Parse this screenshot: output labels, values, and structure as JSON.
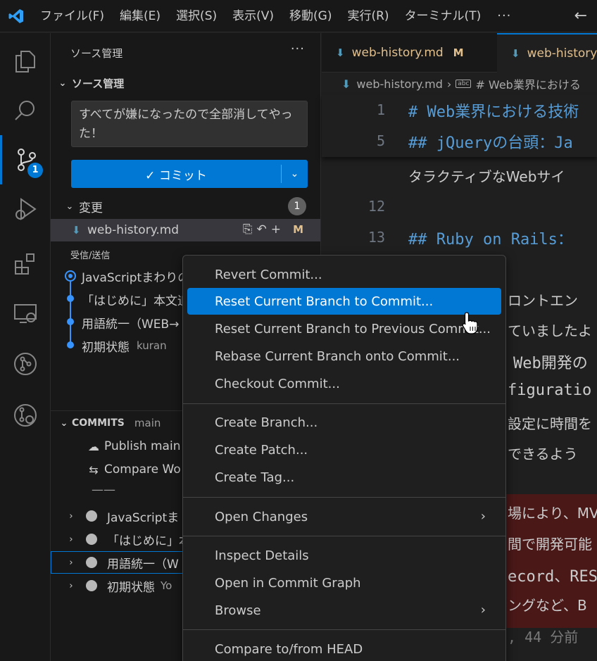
{
  "titlebar": {
    "menus": [
      "ファイル(F)",
      "編集(E)",
      "選択(S)",
      "表示(V)",
      "移動(G)",
      "実行(R)",
      "ターミナル(T)"
    ],
    "more": "···",
    "back": "←"
  },
  "activitybar": {
    "scm_badge": "1"
  },
  "sidebar": {
    "title": "ソース管理",
    "more": "···",
    "scm_section": "ソース管理",
    "commit_message": "すべてが嫌になったので全部消してやった！",
    "commit_button": "✓ コミット",
    "changes_label": "変更",
    "changes_count": "1",
    "file_name": "web-history.md",
    "file_status": "M",
    "incoming_outgoing": "受信/送信",
    "graph": [
      {
        "message": "JavaScriptまわりの"
      },
      {
        "message": "「はじめに」本文追加"
      },
      {
        "message": "用語統一（WEB→"
      },
      {
        "message": "初期状態",
        "author": "kuran"
      }
    ],
    "commits_section": "COMMITS",
    "commits_branch": "main",
    "commit_actions": [
      "Publish main",
      "Compare Wo"
    ],
    "commit_divider": "——",
    "commits": [
      {
        "message": "JavaScriptま"
      },
      {
        "message": "「はじめに」本文"
      },
      {
        "message": "用語統一（W"
      },
      {
        "message": "初期状態",
        "author": "Yo"
      }
    ]
  },
  "editor": {
    "tabs": [
      {
        "label": "web-history.md",
        "status": "M"
      },
      {
        "label": "web-history"
      }
    ],
    "breadcrumb_file": "web-history.md",
    "breadcrumb_symbol": "# Web業界における",
    "lines": [
      {
        "num": "1",
        "text": "# Web業界における技術"
      },
      {
        "num": "5",
        "text": "## jQueryの台頭：Ja"
      },
      {
        "num": "",
        "text": "タラクティブなWebサイ"
      },
      {
        "num": "12",
        "text": ""
      },
      {
        "num": "13",
        "text": "## Ruby on Rails："
      },
      {
        "num": "",
        "text": "ロントエン"
      },
      {
        "num": "",
        "text": "ていましたよ"
      },
      {
        "num": "",
        "text": "Web開発の"
      },
      {
        "num": "",
        "text": "figuratio"
      },
      {
        "num": "",
        "text": "設定に時間を"
      },
      {
        "num": "",
        "text": "できるよう"
      },
      {
        "num": "",
        "text": "場により、MV"
      },
      {
        "num": "",
        "text": "間で開発可能"
      },
      {
        "num": "",
        "text": "ecord、RES"
      },
      {
        "num": "",
        "text": "ングなど、B"
      },
      {
        "num": "",
        "text": ", 44 分前"
      }
    ]
  },
  "context_menu": {
    "groups": [
      [
        "Revert Commit...",
        "Reset Current Branch to Commit...",
        "Reset Current Branch to Previous Commit...",
        "Rebase Current Branch onto Commit...",
        "Checkout Commit..."
      ],
      [
        "Create Branch...",
        "Create Patch...",
        "Create Tag..."
      ],
      [
        "Open Changes"
      ],
      [
        "Inspect Details",
        "Open in Commit Graph",
        "Browse"
      ],
      [
        "Compare to/from HEAD"
      ]
    ],
    "highlighted": "Reset Current Branch to Commit...",
    "submenu_arrow": "›"
  },
  "colors": {
    "accent": "#0078d4",
    "modified": "#e2c08d",
    "graph": "#3794ff"
  }
}
